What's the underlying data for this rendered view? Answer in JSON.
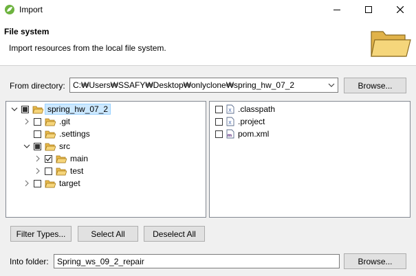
{
  "window": {
    "title": "Import",
    "minimize_icon": "minimize-icon",
    "maximize_icon": "maximize-icon",
    "close_icon": "close-icon"
  },
  "header": {
    "title": "File system",
    "description": "Import resources from the local file system.",
    "image": "folder-open-icon"
  },
  "from_directory": {
    "label": "From directory:",
    "value": "C:₩Users₩SSAFY₩Desktop₩onlyclone₩spring_hw_07_2",
    "browse_label": "Browse..."
  },
  "tree": [
    {
      "label": "spring_hw_07_2",
      "expanded": true,
      "check": "partial",
      "selected": true
    },
    {
      "label": ".git",
      "expanded": false,
      "check": "unchecked"
    },
    {
      "label": ".settings",
      "expanded": null,
      "check": "unchecked"
    },
    {
      "label": "src",
      "expanded": true,
      "check": "partial"
    },
    {
      "label": "main",
      "expanded": false,
      "check": "checked"
    },
    {
      "label": "test",
      "expanded": false,
      "check": "unchecked"
    },
    {
      "label": "target",
      "expanded": false,
      "check": "unchecked"
    }
  ],
  "files": [
    {
      "label": ".classpath",
      "icon": "xml-file-icon",
      "check": "unchecked"
    },
    {
      "label": ".project",
      "icon": "xml-file-icon",
      "check": "unchecked"
    },
    {
      "label": "pom.xml",
      "icon": "maven-pom-icon",
      "check": "unchecked"
    }
  ],
  "actions": {
    "filter_types": "Filter Types...",
    "select_all": "Select All",
    "deselect_all": "Deselect All"
  },
  "into_folder": {
    "label": "Into folder:",
    "value": "Spring_ws_09_2_repair",
    "browse_label": "Browse..."
  },
  "colors": {
    "selection_bg": "#cce8ff",
    "folder": "#e8b94a",
    "button_bg": "#e1e1e1"
  }
}
